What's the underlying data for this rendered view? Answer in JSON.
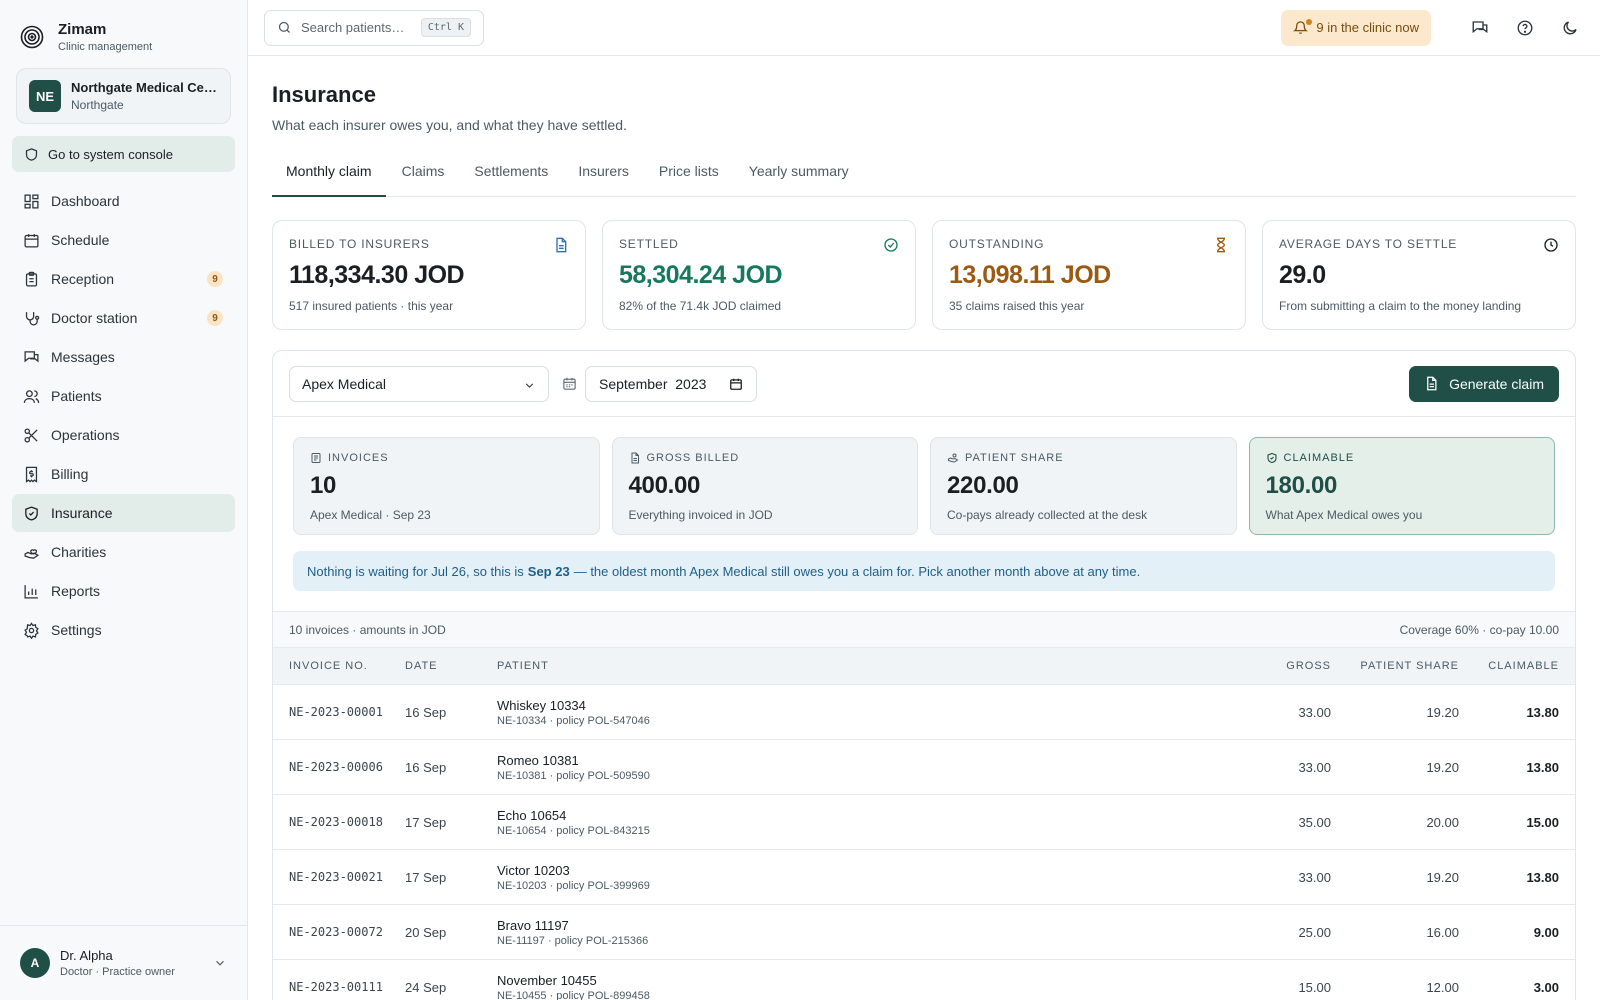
{
  "brand": {
    "name": "Zimam",
    "subtitle": "Clinic management"
  },
  "clinic": {
    "initials": "NE",
    "name": "Northgate Medical Ce…",
    "location": "Northgate"
  },
  "console_button": "Go to system console",
  "nav": [
    {
      "label": "Dashboard",
      "icon": "dashboard-icon",
      "badge": null
    },
    {
      "label": "Schedule",
      "icon": "calendar-icon",
      "badge": null
    },
    {
      "label": "Reception",
      "icon": "clipboard-icon",
      "badge": "9"
    },
    {
      "label": "Doctor station",
      "icon": "stethoscope-icon",
      "badge": "9"
    },
    {
      "label": "Messages",
      "icon": "messages-icon",
      "badge": null
    },
    {
      "label": "Patients",
      "icon": "users-icon",
      "badge": null
    },
    {
      "label": "Operations",
      "icon": "scissors-icon",
      "badge": null
    },
    {
      "label": "Billing",
      "icon": "receipt-icon",
      "badge": null
    },
    {
      "label": "Insurance",
      "icon": "shield-icon",
      "badge": null,
      "active": true
    },
    {
      "label": "Charities",
      "icon": "hand-heart-icon",
      "badge": null
    },
    {
      "label": "Reports",
      "icon": "bar-chart-icon",
      "badge": null
    },
    {
      "label": "Settings",
      "icon": "gear-icon",
      "badge": null
    }
  ],
  "user": {
    "initial": "A",
    "name": "Dr. Alpha",
    "role": "Doctor · Practice owner"
  },
  "topbar": {
    "search_placeholder": "Search patients…",
    "shortcut": "Ctrl K",
    "clinic_now": "9 in the clinic now"
  },
  "page": {
    "title": "Insurance",
    "subtitle": "What each insurer owes you, and what they have settled."
  },
  "tabs": [
    {
      "label": "Monthly claim",
      "active": true
    },
    {
      "label": "Claims"
    },
    {
      "label": "Settlements"
    },
    {
      "label": "Insurers"
    },
    {
      "label": "Price lists"
    },
    {
      "label": "Yearly summary"
    }
  ],
  "stats": [
    {
      "label": "Billed to insurers",
      "value": "118,334.30 JOD",
      "note": "517 insured patients · this year",
      "color": "#1a1f24",
      "icon": "document-icon"
    },
    {
      "label": "Settled",
      "value": "58,304.24 JOD",
      "note": "82% of the 71.4k JOD claimed",
      "color": "#16795a",
      "icon": "check-circle-icon"
    },
    {
      "label": "Outstanding",
      "value": "13,098.11 JOD",
      "note": "35 claims raised this year",
      "color": "#9a5a12",
      "icon": "hourglass-icon"
    },
    {
      "label": "Average days to settle",
      "value": "29.0",
      "note": "From submitting a claim to the money landing",
      "color": "#1a1f24",
      "icon": "clock-icon"
    }
  ],
  "controls": {
    "insurer": "Apex Medical",
    "month": "September  2023",
    "generate_button": "Generate claim"
  },
  "summary": [
    {
      "label": "Invoices",
      "value": "10",
      "note": "Apex Medical · Sep 23",
      "icon": "list-icon"
    },
    {
      "label": "Gross billed",
      "value": "400.00",
      "note": "Everything invoiced in JOD",
      "icon": "file-icon"
    },
    {
      "label": "Patient share",
      "value": "220.00",
      "note": "Co-pays already collected at the desk",
      "icon": "hand-coins-icon"
    },
    {
      "label": "Claimable",
      "value": "180.00",
      "note": "What Apex Medical owes you",
      "icon": "shield-check-icon",
      "highlight": true
    }
  ],
  "banner": {
    "before": "Nothing is waiting for Jul 26, so this is",
    "bold": "Sep 23",
    "after": "— the oldest month Apex Medical still owes you a claim for. Pick another month above at any time."
  },
  "table": {
    "meta_left": "10 invoices · amounts in JOD",
    "meta_right": "Coverage 60% · co-pay 10.00",
    "headers": {
      "invoice": "Invoice no.",
      "date": "Date",
      "patient": "Patient",
      "gross": "Gross",
      "share": "Patient share",
      "claimable": "Claimable"
    },
    "rows": [
      {
        "invoice": "NE-2023-00001",
        "date": "16 Sep",
        "patient": "Whiskey 10334",
        "meta": "NE-10334 · policy POL-547046",
        "gross": "33.00",
        "share": "19.20",
        "claimable": "13.80"
      },
      {
        "invoice": "NE-2023-00006",
        "date": "16 Sep",
        "patient": "Romeo 10381",
        "meta": "NE-10381 · policy POL-509590",
        "gross": "33.00",
        "share": "19.20",
        "claimable": "13.80"
      },
      {
        "invoice": "NE-2023-00018",
        "date": "17 Sep",
        "patient": "Echo 10654",
        "meta": "NE-10654 · policy POL-843215",
        "gross": "35.00",
        "share": "20.00",
        "claimable": "15.00"
      },
      {
        "invoice": "NE-2023-00021",
        "date": "17 Sep",
        "patient": "Victor 10203",
        "meta": "NE-10203 · policy POL-399969",
        "gross": "33.00",
        "share": "19.20",
        "claimable": "13.80"
      },
      {
        "invoice": "NE-2023-00072",
        "date": "20 Sep",
        "patient": "Bravo 11197",
        "meta": "NE-11197 · policy POL-215366",
        "gross": "25.00",
        "share": "16.00",
        "claimable": "9.00"
      },
      {
        "invoice": "NE-2023-00111",
        "date": "24 Sep",
        "patient": "November 10455",
        "meta": "NE-10455 · policy POL-899458",
        "gross": "15.00",
        "share": "12.00",
        "claimable": "3.00"
      }
    ]
  }
}
